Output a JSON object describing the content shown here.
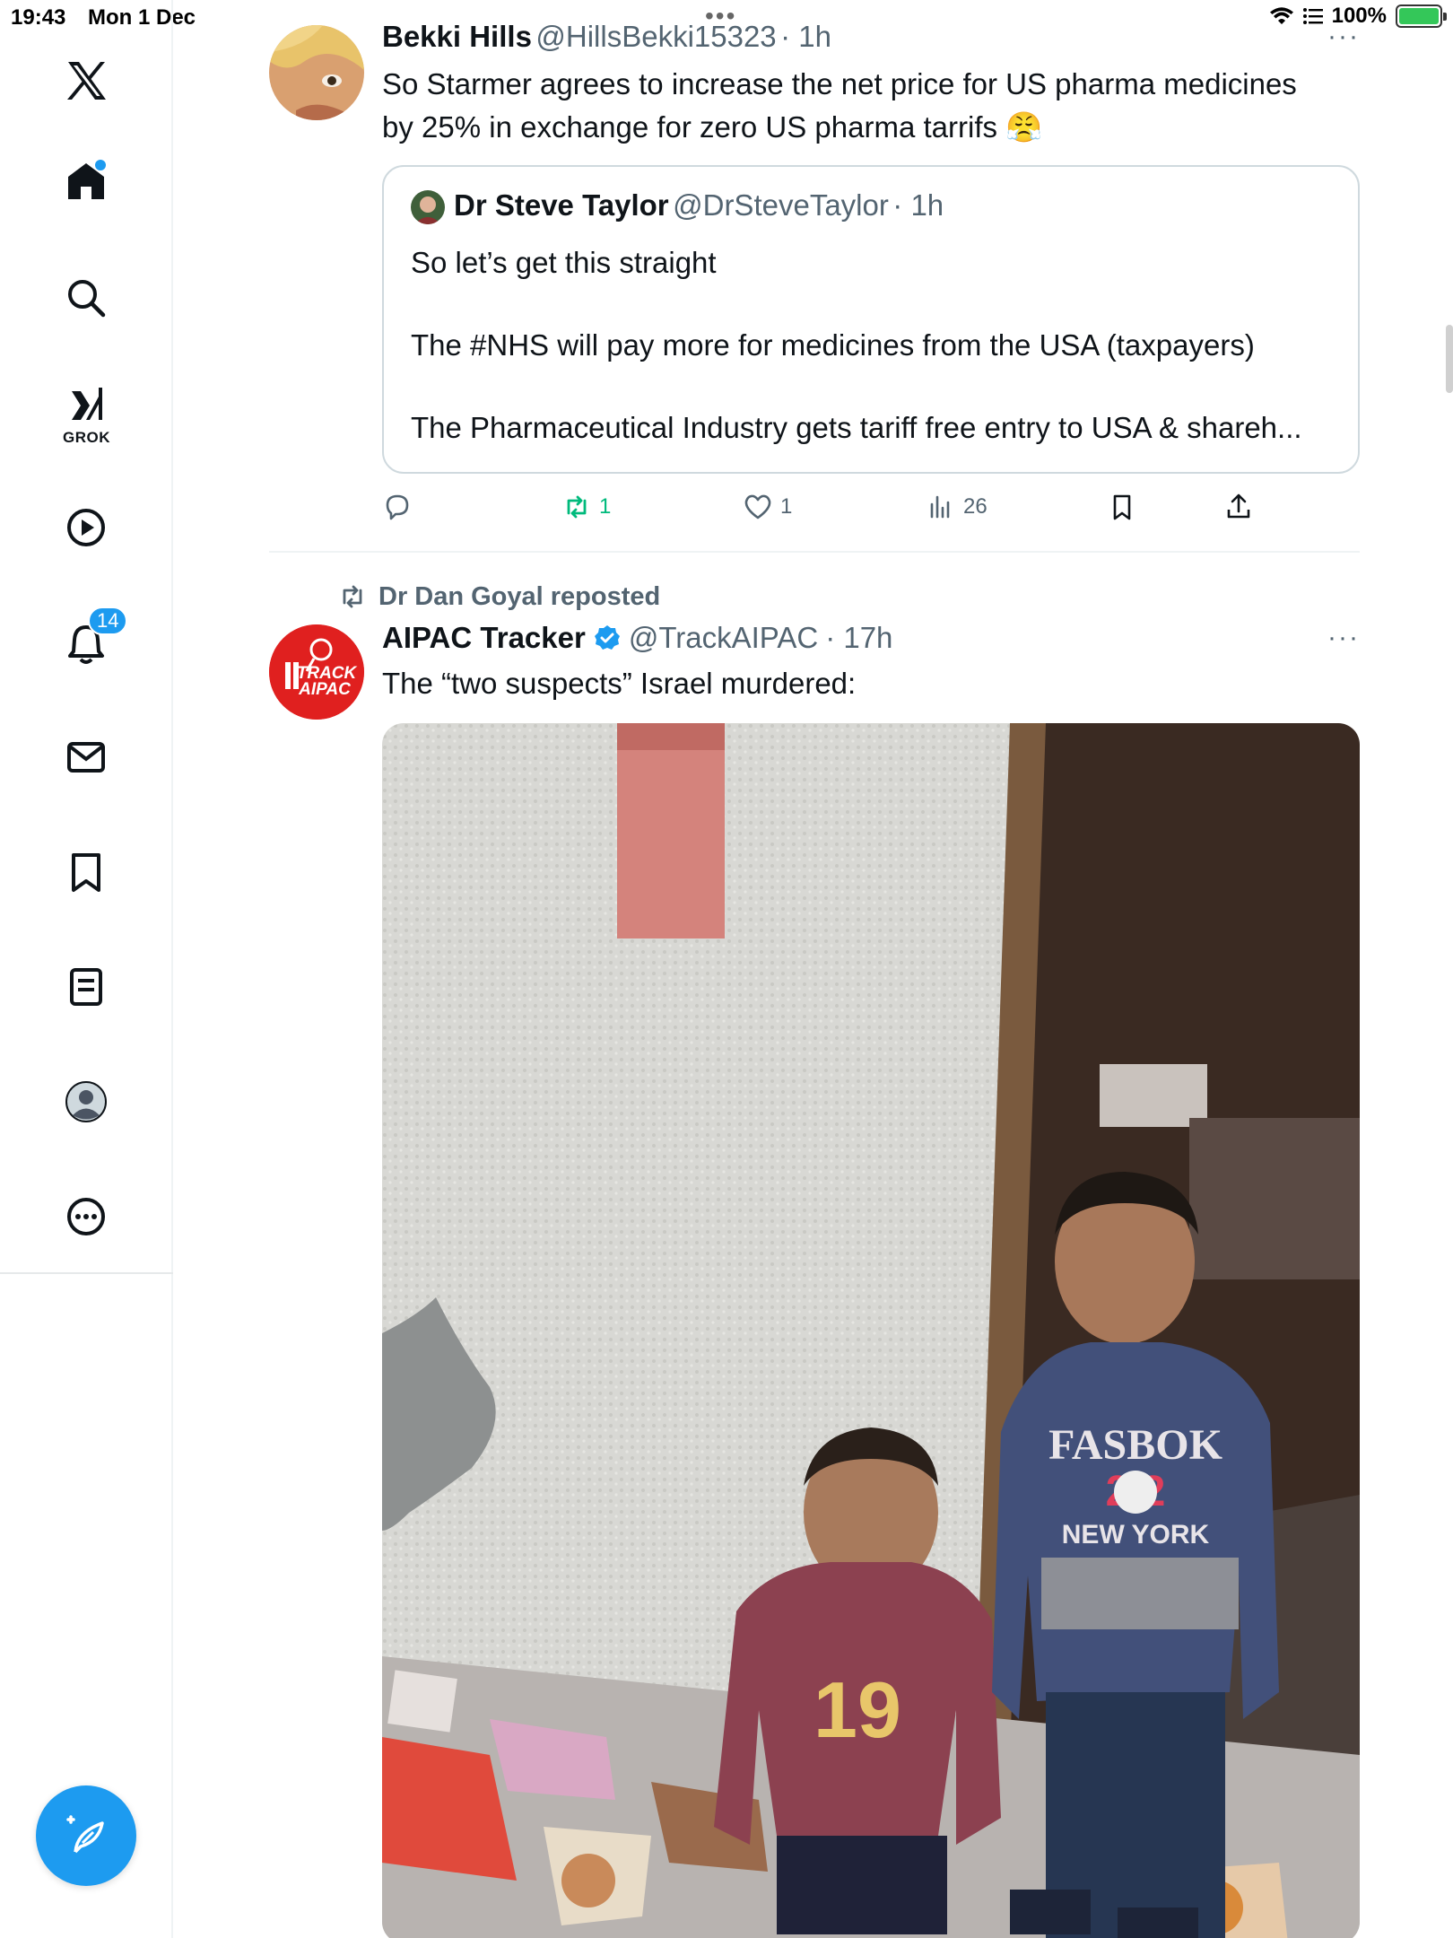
{
  "status_bar": {
    "time": "19:43",
    "date": "Mon 1 Dec",
    "battery": "100%"
  },
  "sidebar": {
    "logo_icon": "x-logo-icon",
    "grok_label": "GROK",
    "notifications_badge": "14",
    "items": [
      "home-icon",
      "search-icon",
      "grok-icon",
      "video-icon",
      "bell-icon",
      "mail-icon",
      "bookmark-icon",
      "list-icon",
      "profile-icon",
      "more-icon"
    ]
  },
  "tweet1": {
    "name": "Bekki Hills",
    "handle": "@HillsBekki15323",
    "time": "· 1h",
    "text_line1": "So Starmer agrees to increase the net price for US pharma medicines",
    "text_line2": "by 25% in exchange for zero US pharma tarrifs",
    "emoji": "😤",
    "quote": {
      "name": "Dr Steve Taylor",
      "handle": "@DrSteveTaylor",
      "time": "· 1h",
      "line1": "So let’s get this straight",
      "line2": "The #NHS will pay more for medicines from the USA (taxpayers)",
      "line3": "The Pharmaceutical Industry gets tariff free entry to USA & shareh..."
    },
    "actions": {
      "reposts": "1",
      "likes": "1",
      "views": "26"
    }
  },
  "tweet2": {
    "repost_label": "Dr Dan Goyal reposted",
    "name": "AIPAC Tracker",
    "handle": "@TrackAIPAC",
    "time": "· 17h",
    "text": "The “two suspects” Israel murdered:",
    "avatar_text_1": "TRACK",
    "avatar_text_2": "AIPAC",
    "shirt_1": "19",
    "shirt_2_line1": "FASBOK",
    "shirt_2_line2": "2  2",
    "shirt_2_line3": "NEW YORK"
  },
  "colors": {
    "accent": "#1d9bf0",
    "repost_green": "#00ba7c",
    "muted": "#536471",
    "aipac_red": "#e0201f"
  }
}
